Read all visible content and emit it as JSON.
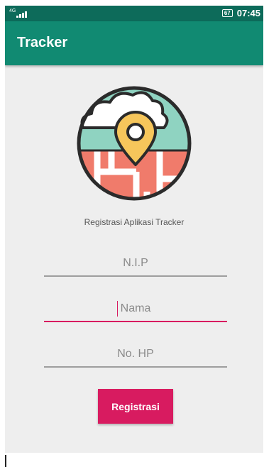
{
  "status_bar": {
    "network": "4G",
    "battery": "67",
    "time": "07:45"
  },
  "app_bar": {
    "title": "Tracker"
  },
  "caption": "Registrasi Aplikasi Tracker",
  "form": {
    "nip_placeholder": "N.I.P",
    "nama_placeholder": "Nama",
    "hp_placeholder": "No. HP",
    "submit_label": "Registrasi"
  },
  "colors": {
    "status_bar": "#0d6b5a",
    "app_bar": "#118a72",
    "accent": "#d81b60",
    "background": "#eeeeee"
  },
  "icons": {
    "signal": "signal-bars-icon",
    "battery": "battery-icon",
    "logo": "map-pin-cloud-logo"
  }
}
